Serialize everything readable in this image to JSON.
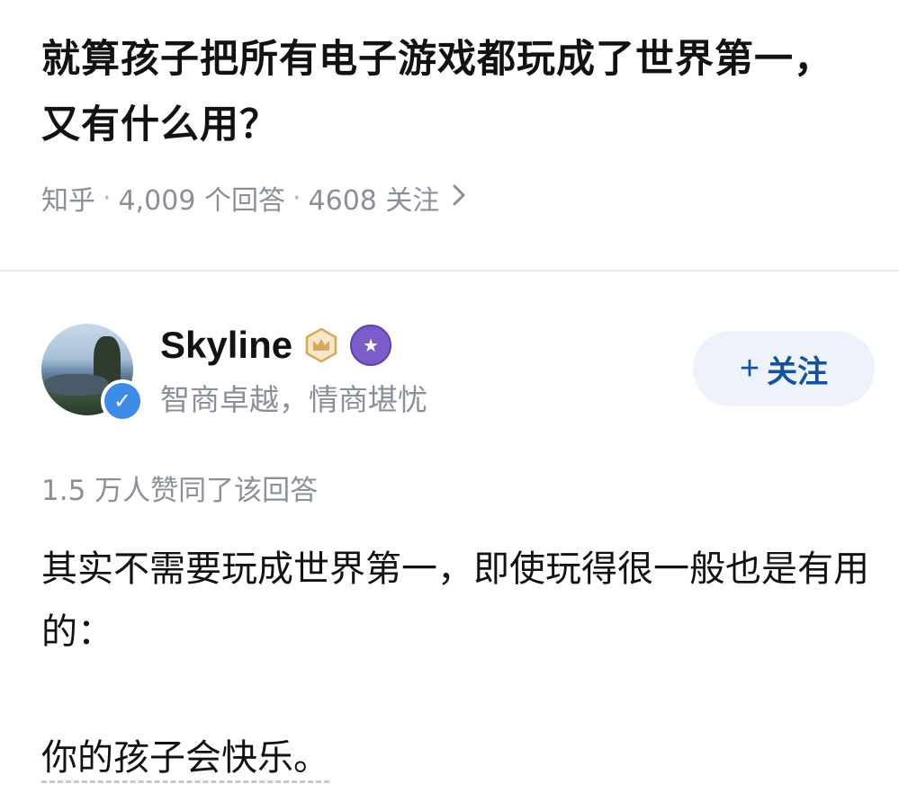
{
  "question": {
    "title": "就算孩子把所有电子游戏都玩成了世界第一，又有什么用？",
    "source": "知乎",
    "answers": "4,009 个回答",
    "followers": "4608 关注",
    "separator": "·"
  },
  "author": {
    "name": "Skyline",
    "bio": "智商卓越，情商堪忧",
    "follow_label": "关注",
    "follow_prefix": "+"
  },
  "answer": {
    "likes": "1.5 万人赞同了该回答",
    "paragraphs": [
      "其实不需要玩成世界第一，即使玩得很一般也是有用的：",
      "你的孩子会快乐。"
    ]
  },
  "colors": {
    "accent": "#175199",
    "verified": "#3c8ce7",
    "muted": "#8a8f99"
  },
  "icons": {
    "chevron": "chevron-right-icon",
    "crown": "crown-badge-icon",
    "star": "star-badge-icon",
    "verified": "verified-check-icon"
  }
}
